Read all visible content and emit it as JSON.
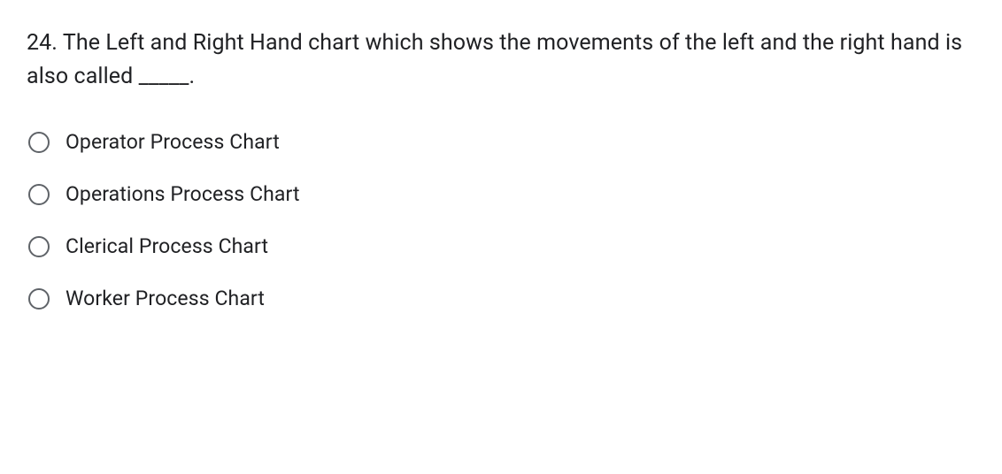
{
  "question": {
    "number": "24.",
    "text": "The Left and Right Hand chart which shows the movements of the left and the right hand is also called _____."
  },
  "options": [
    {
      "label": "Operator Process Chart"
    },
    {
      "label": "Operations Process Chart"
    },
    {
      "label": "Clerical Process Chart"
    },
    {
      "label": "Worker Process Chart"
    }
  ]
}
